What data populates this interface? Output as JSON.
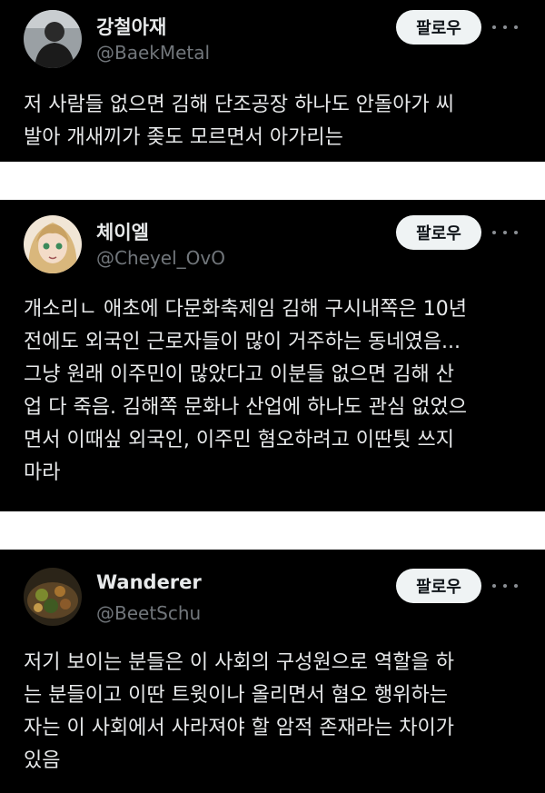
{
  "follow_label": "팔로우",
  "posts": [
    {
      "name": "강철아재",
      "handle": "@BaekMetal",
      "lines": [
        "저 사람들 없으면 김해 단조공장 하나도 안돌아가 씨",
        "발아 개새끼가 좆도 모르면서 아가리는"
      ]
    },
    {
      "name": "체이엘",
      "handle": "@Cheyel_OvO",
      "lines": [
        "개소리ㄴ 애초에 다문화축제임 김해 구시내쪽은 10년",
        "전에도 외국인 근로자들이 많이 거주하는 동네였음...",
        "그냥 원래 이주민이 많았다고 이분들 없으면 김해 산",
        "업 다 죽음. 김해쪽 문화나 산업에 하나도 관심 없었으",
        "면서 이때싶 외국인, 이주민 혐오하려고 이딴틧 쓰지",
        "마라"
      ]
    },
    {
      "name": "Wanderer",
      "handle": "@BeetSchu",
      "lines": [
        "저기 보이는 분들은 이 사회의 구성원으로 역할을 하",
        "는 분들이고 이딴 트윗이나 올리면서 혐오 행위하는",
        "자는 이 사회에서 사라져야 할 암적 존재라는 차이가",
        "있음"
      ]
    }
  ]
}
